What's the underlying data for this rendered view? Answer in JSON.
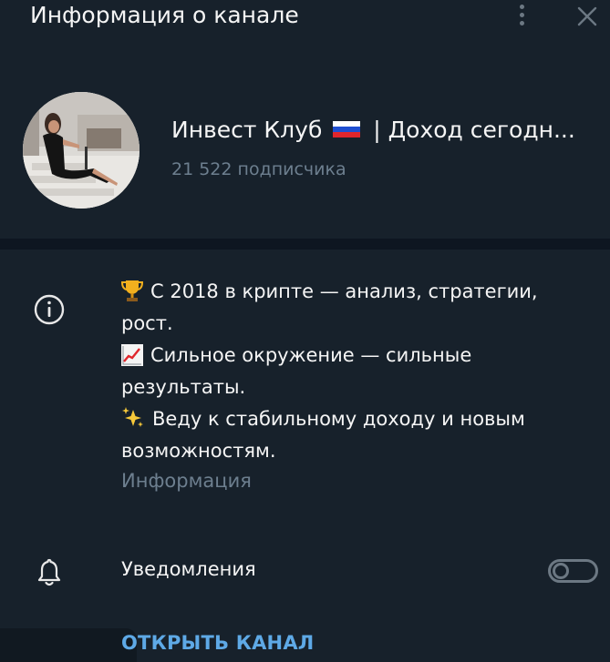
{
  "header": {
    "title": "Информация о канале",
    "more_icon": "vertical-dots-icon",
    "close_icon": "close-icon"
  },
  "channel": {
    "name": "Инвест Клуб",
    "name_suffix": "| Доход сегодн...",
    "subscribers": "21 522 подписчика",
    "flag": "russian-flag"
  },
  "about": {
    "lines": [
      {
        "emoji": "trophy-icon",
        "text": "С 2018 в крипте — анализ, стратегии,"
      },
      {
        "emoji": "",
        "text": "рост."
      },
      {
        "emoji": "chart-increasing-icon",
        "text": "Сильное окружение — сильные"
      },
      {
        "emoji": "",
        "text": "результаты."
      },
      {
        "emoji": "sparkles-icon",
        "text": "Веду к стабильному доходу и новым"
      },
      {
        "emoji": "",
        "text": "возможностям."
      }
    ],
    "label": "Информация"
  },
  "notifications": {
    "label": "Уведомления",
    "enabled": false
  },
  "actions": {
    "open_channel": "ОТКРЫТЬ КАНАЛ"
  },
  "colors": {
    "background": "#17212b",
    "separator": "#0e1621",
    "accent": "#5ea9e6",
    "muted": "#6d7f8f"
  }
}
